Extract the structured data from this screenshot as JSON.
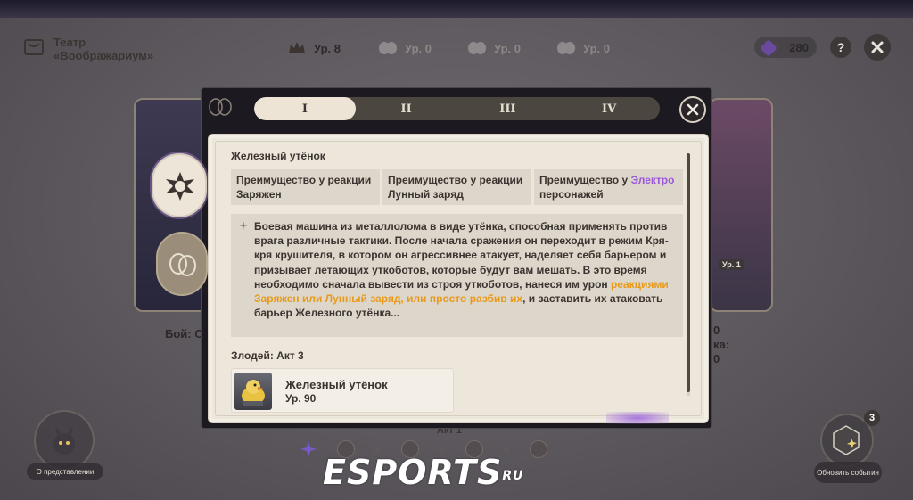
{
  "topbar": {
    "title_line1": "Театр",
    "title_line2": "«Воображариум»",
    "levels": [
      {
        "label": "Ур. 8",
        "icon": "crown-icon"
      },
      {
        "label": "Ур. 0",
        "icon": "moth-icon"
      },
      {
        "label": "Ур. 0",
        "icon": "moth-icon"
      },
      {
        "label": "Ур. 0",
        "icon": "moth-icon"
      }
    ],
    "currency": "280",
    "help_label": "?"
  },
  "tabs": [
    "I",
    "II",
    "III",
    "IV"
  ],
  "active_tab": 0,
  "boss": {
    "name": "Железный утёнок",
    "advantages": [
      {
        "text": "Преимущество у реакции Заряжен"
      },
      {
        "text": "Преимущество у реакции Лунный заряд"
      },
      {
        "prefix": "Преимущество у ",
        "highlight": "Электро",
        "suffix": " персонажей"
      }
    ],
    "description_plain1": "Боевая машина из металлолома в виде утёнка, способная применять против врага различные тактики. После начала сражения он переходит в режим Кря-кря крушителя, в котором он агрессивнее атакует, наделяет себя барьером и призывает летающих уткоботов, которые будут вам мешать. В это время необходимо сначала вывести из строя уткоботов, нанеся им урон ",
    "description_highlight": "реакциями Заряжен или Лунный заряд, или просто разбив их",
    "description_plain2": ", и заставить их атаковать барьер Железного утёнка...",
    "villain_label": "Злодей: Акт 3",
    "enemy_name": "Железный утёнок",
    "enemy_level": "Ур. 90"
  },
  "background": {
    "left_label": "Бой: С",
    "right_label_line1": "0",
    "right_label_line2": "ка:",
    "right_label_line3": "0",
    "right_level_badge": "Ур. 1",
    "act_label": "Акт 1",
    "left_button": "О представлении",
    "right_button": "Обновить события",
    "right_count": "3"
  },
  "watermark": {
    "main": "ESPORTS",
    "sup": "RU"
  },
  "colors": {
    "accent_electro": "#9b57d9",
    "highlight_orange": "#e89a1a",
    "panel_bg": "#ece6db",
    "frame_bg": "#1c1a20"
  }
}
